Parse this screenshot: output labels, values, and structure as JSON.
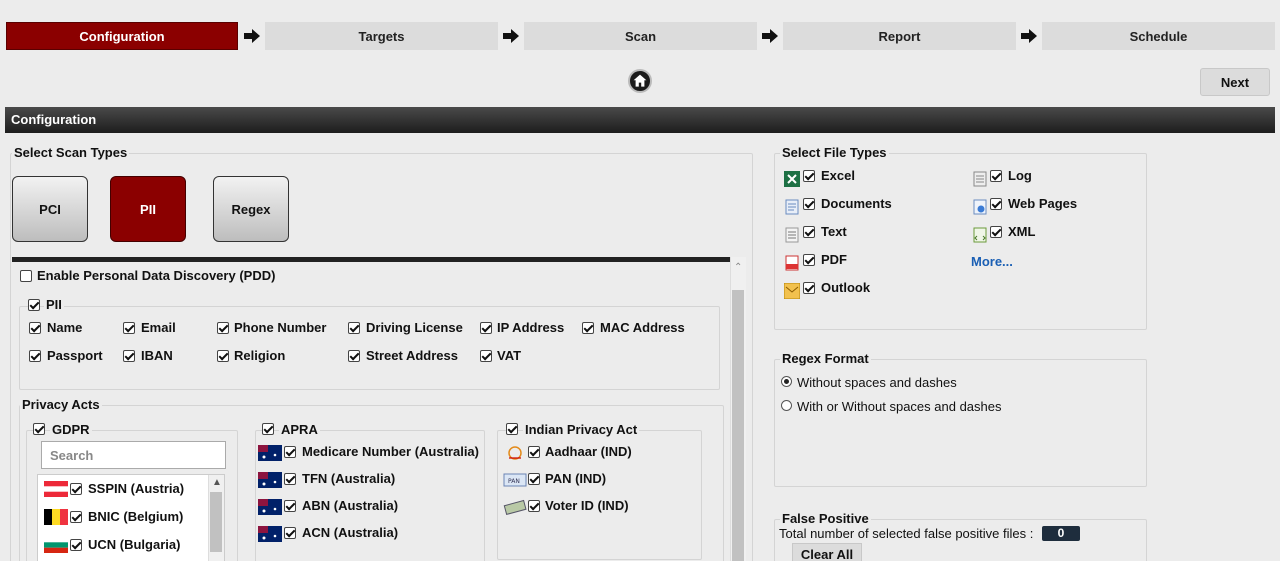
{
  "wizard": {
    "steps": [
      "Configuration",
      "Targets",
      "Scan",
      "Report",
      "Schedule"
    ]
  },
  "next_label": "Next",
  "section_title": "Configuration",
  "scan_types": {
    "legend": "Select Scan Types",
    "buttons": [
      "PCI",
      "PII",
      "Regex"
    ],
    "active": "PII"
  },
  "pdd": {
    "label": "Enable Personal Data Discovery (PDD)",
    "checked": false
  },
  "pii": {
    "legend": "PII",
    "items": [
      "Name",
      "Email",
      "Phone Number",
      "Driving License",
      "IP Address",
      "MAC Address",
      "Passport",
      "IBAN",
      "Religion",
      "Street Address",
      "VAT"
    ]
  },
  "privacy_acts": {
    "legend": "Privacy Acts",
    "gdpr": {
      "label": "GDPR",
      "search_placeholder": "Search",
      "items": [
        "SSPIN (Austria)",
        "BNIC (Belgium)",
        "UCN (Bulgaria)"
      ]
    },
    "apra": {
      "label": "APRA",
      "items": [
        "Medicare Number (Australia)",
        "TFN (Australia)",
        "ABN (Australia)",
        "ACN (Australia)"
      ]
    },
    "indian": {
      "label": "Indian Privacy Act",
      "items": [
        "Aadhaar (IND)",
        "PAN (IND)",
        "Voter ID (IND)"
      ]
    }
  },
  "file_types": {
    "legend": "Select File Types",
    "left": [
      "Excel",
      "Documents",
      "Text",
      "PDF",
      "Outlook"
    ],
    "right": [
      "Log",
      "Web Pages",
      "XML"
    ],
    "more": "More..."
  },
  "regex_format": {
    "legend": "Regex Format",
    "options": [
      "Without spaces and dashes",
      "With or Without spaces and dashes"
    ],
    "selected": 0
  },
  "false_positive": {
    "legend": "False Positive",
    "total_label": "Total number of selected false positive files :",
    "count": "0",
    "clear_label": "Clear All"
  },
  "colors": {
    "accent": "#8b0000",
    "header_bar": "#2a2a2a",
    "link": "#1a5fb4"
  }
}
